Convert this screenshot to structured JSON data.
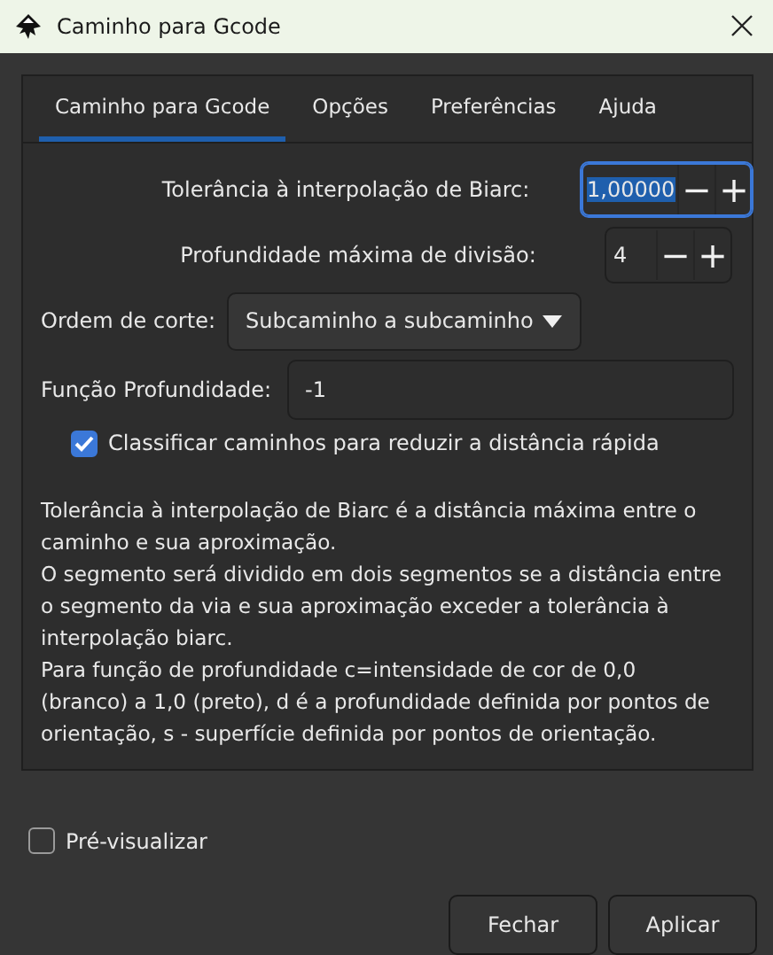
{
  "window": {
    "title": "Caminho para Gcode"
  },
  "tabs": [
    {
      "label": "Caminho para Gcode",
      "selected": true
    },
    {
      "label": "Opções",
      "selected": false
    },
    {
      "label": "Preferências",
      "selected": false
    },
    {
      "label": "Ajuda",
      "selected": false
    }
  ],
  "spin_fields": [
    {
      "label": "Tolerância à interpolação de Biarc:",
      "value": "1,00000",
      "focused": true,
      "minus": "−",
      "plus": "+"
    },
    {
      "label": "Profundidade máxima de divisão:",
      "value": "4",
      "focused": false,
      "minus": "−",
      "plus": "+"
    }
  ],
  "cut_order": {
    "label": "Ordem de corte:",
    "value": "Subcaminho a subcaminho"
  },
  "depth_function": {
    "label": "Função Profundidade:",
    "value": "-1"
  },
  "sort_paths": {
    "label": "Classificar caminhos para reduzir a distância rápida",
    "checked": true
  },
  "description": [
    "Tolerância à interpolação de Biarc é a distância máxima entre o caminho e sua aproximação.",
    "O segmento será dividido em dois segmentos se a distância entre o segmento da via e sua aproximação exceder a tolerância à interpolação biarc.",
    "Para função de profundidade c=intensidade de cor de 0,0 (branco) a 1,0 (preto), d é a profundidade definida por pontos de orientação, s - superfície definida por pontos de orientação."
  ],
  "preview": {
    "label": "Pré-visualizar",
    "checked": false
  },
  "buttons": [
    "Fechar",
    "Aplicar"
  ]
}
